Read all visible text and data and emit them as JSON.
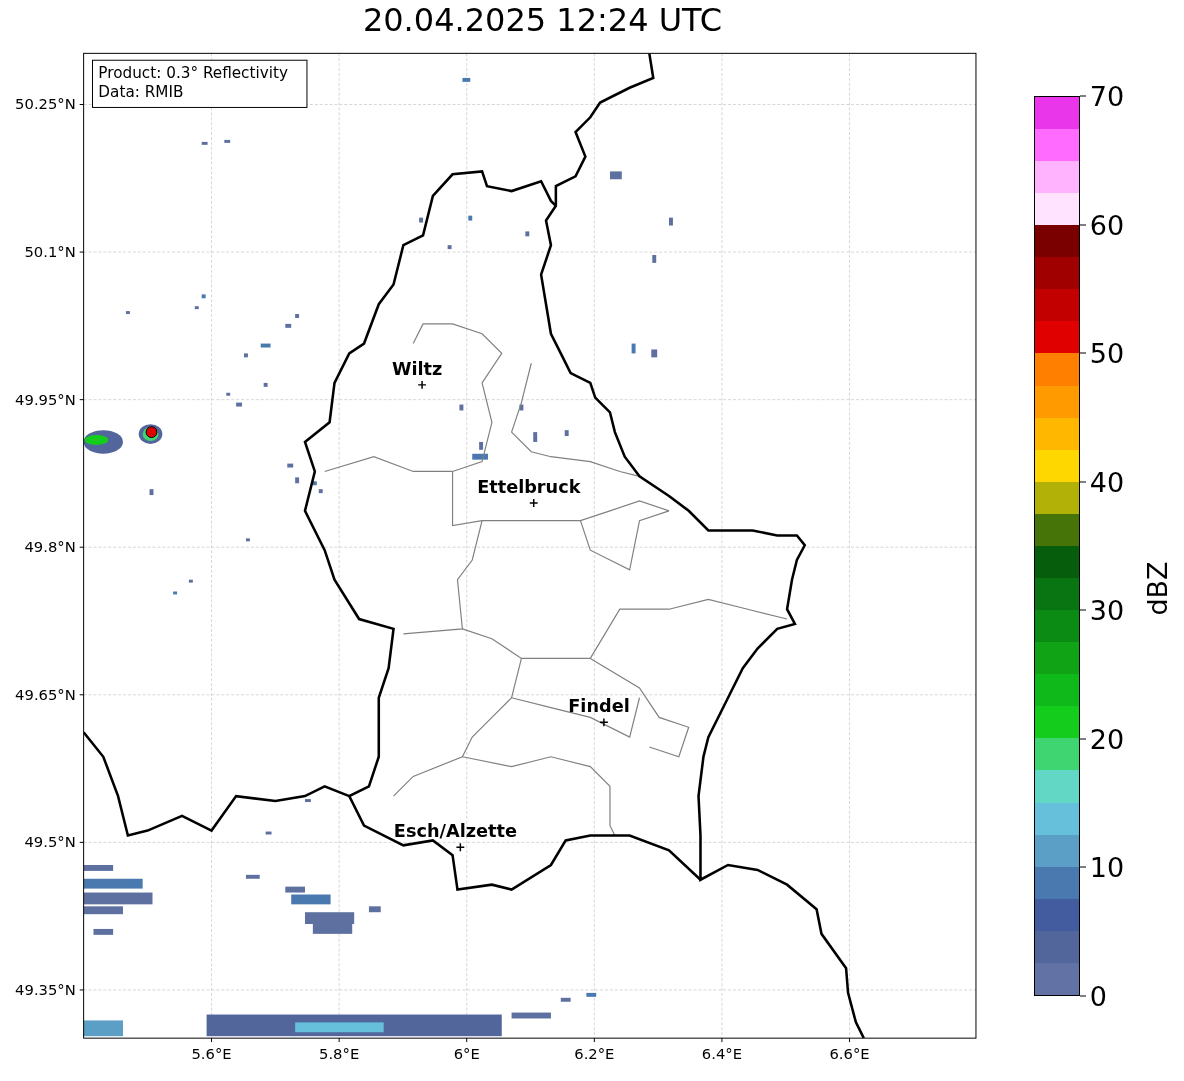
{
  "title": "20.04.2025 12:24 UTC",
  "legend": [
    "Product: 0.3° Reflectivity",
    "Data: RMIB"
  ],
  "x_ticks": [
    "5.6°E",
    "5.8°E",
    "6°E",
    "6.2°E",
    "6.4°E",
    "6.6°E"
  ],
  "y_ticks": [
    "50.25°N",
    "50.1°N",
    "49.95°N",
    "49.8°N",
    "49.65°N",
    "49.5°N",
    "49.35°N"
  ],
  "cities": [
    {
      "name": "Wiltz"
    },
    {
      "name": "Ettelbruck"
    },
    {
      "name": "Findel"
    },
    {
      "name": "Esch/Alzette"
    }
  ],
  "colorbar": {
    "label": "dBZ",
    "ticks": [
      "70",
      "60",
      "50",
      "40",
      "30",
      "20",
      "10",
      "0"
    ],
    "bands": [
      {
        "color": "#6272a4"
      },
      {
        "color": "#52669c"
      },
      {
        "color": "#435c9f"
      },
      {
        "color": "#4a79b0"
      },
      {
        "color": "#5b9ec6"
      },
      {
        "color": "#66c0dc"
      },
      {
        "color": "#63d7c6"
      },
      {
        "color": "#3fd672"
      },
      {
        "color": "#13cc1b"
      },
      {
        "color": "#10b91a"
      },
      {
        "color": "#10a316"
      },
      {
        "color": "#0c8b14"
      },
      {
        "color": "#097512"
      },
      {
        "color": "#065d0b"
      },
      {
        "color": "#467409"
      },
      {
        "color": "#b1b108"
      },
      {
        "color": "#ffd700"
      },
      {
        "color": "#ffb700"
      },
      {
        "color": "#ff9a00"
      },
      {
        "color": "#ff7f00"
      },
      {
        "color": "#e00000"
      },
      {
        "color": "#c20000"
      },
      {
        "color": "#a00000"
      },
      {
        "color": "#7a0000"
      },
      {
        "color": "#ffe3ff"
      },
      {
        "color": "#ffb3ff"
      },
      {
        "color": "#ff6aff"
      },
      {
        "color": "#ea36ea"
      }
    ]
  }
}
